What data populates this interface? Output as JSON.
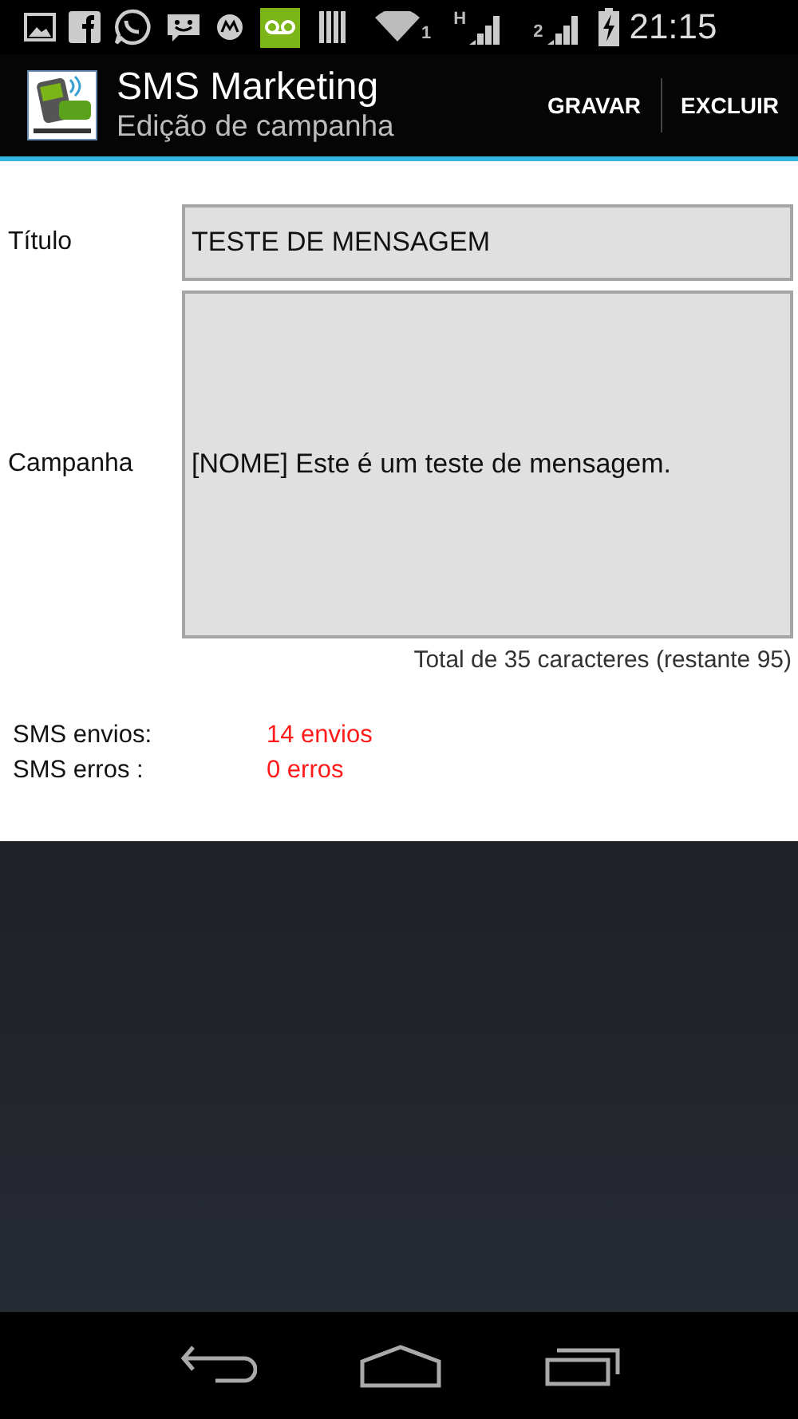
{
  "status_bar": {
    "sim1_label": "1",
    "network_type": "H",
    "sim2_label": "2",
    "time": "21:15"
  },
  "action_bar": {
    "title": "SMS Marketing",
    "subtitle": "Edição de campanha",
    "actions": [
      "GRAVAR",
      "EXCLUIR"
    ]
  },
  "form": {
    "fields": [
      {
        "label": "Título",
        "value": "TESTE DE MENSAGEM",
        "kind": "line"
      },
      {
        "label": "Campanha",
        "value": "[NOME] Este é um teste de mensagem.",
        "kind": "area"
      }
    ],
    "counter": "Total de 35 caracteres (restante 95)"
  },
  "stats": [
    {
      "label": "SMS envios:",
      "value": "14 envios"
    },
    {
      "label": "SMS erros :",
      "value": "0 erros"
    }
  ]
}
